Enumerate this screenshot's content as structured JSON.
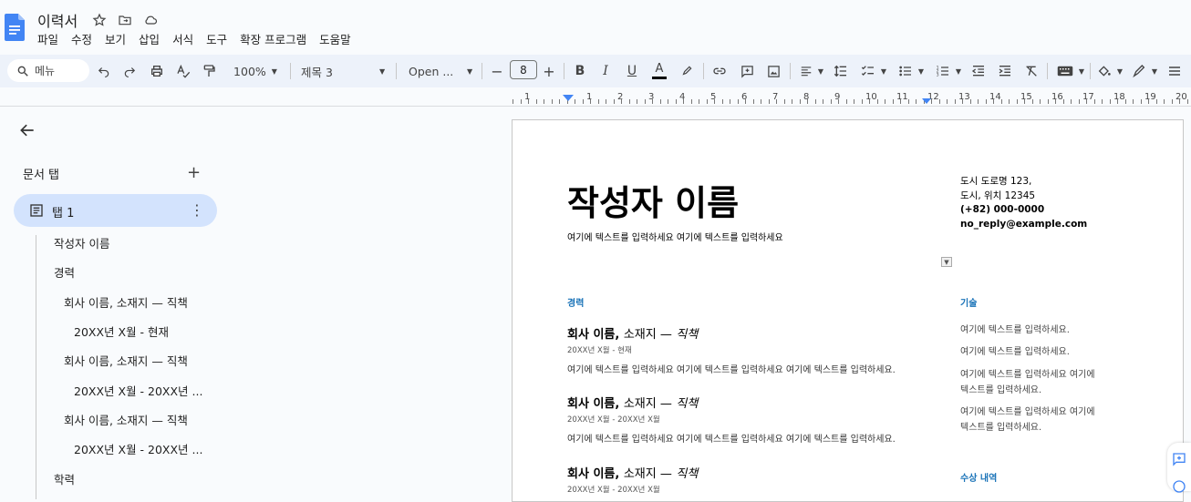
{
  "app": {
    "doc_title": "이력서"
  },
  "menu": [
    "파일",
    "수정",
    "보기",
    "삽입",
    "서식",
    "도구",
    "확장 프로그램",
    "도움말"
  ],
  "toolbar": {
    "search_placeholder": "메뉴",
    "zoom": "100%",
    "style": "제목 3",
    "font": "Open ...",
    "font_size": "8",
    "minus": "−",
    "plus": "+"
  },
  "ruler": {
    "labels": [
      "1",
      "1",
      "2",
      "3",
      "4",
      "5",
      "6",
      "7",
      "8",
      "9",
      "10",
      "11",
      "12",
      "13",
      "14",
      "15",
      "16",
      "17",
      "18",
      "19",
      "20"
    ]
  },
  "sidebar": {
    "section_title": "문서 탭",
    "tab_label": "탭 1",
    "outline": [
      {
        "text": "작성자 이름",
        "level": 1
      },
      {
        "text": "경력",
        "level": 1
      },
      {
        "text": "회사 이름, 소재지 — 직책",
        "level": 2
      },
      {
        "text": "20XX년 X월 - 현재",
        "level": 3
      },
      {
        "text": "회사 이름, 소재지 — 직책",
        "level": 2
      },
      {
        "text": "20XX년 X월 - 20XX년 ...",
        "level": 3
      },
      {
        "text": "회사 이름, 소재지 — 직책",
        "level": 2
      },
      {
        "text": "20XX년 X월 - 20XX년 ...",
        "level": 3
      },
      {
        "text": "학력",
        "level": 1
      }
    ]
  },
  "doc": {
    "name": "작성자 이름",
    "subtitle": "여기에 텍스트를 입력하세요 여기에 텍스트를 입력하세요",
    "address1": "도시 도로명 123,",
    "address2": "도시, 위치 12345",
    "phone": "(+82) 000-0000",
    "email": "no_reply@example.com",
    "experience_heading": "경력",
    "skills_heading": "기술",
    "awards_heading": "수상 내역",
    "jobs": [
      {
        "company": "회사 이름,",
        "location": "소재지 —",
        "title": "직책",
        "date": "20XX년 X월 - 현재",
        "desc": "여기에 텍스트를 입력하세요 여기에 텍스트를 입력하세요 여기에 텍스트를 입력하세요."
      },
      {
        "company": "회사 이름,",
        "location": "소재지 —",
        "title": "직책",
        "date": "20XX년 X월 - 20XX년 X월",
        "desc": "여기에 텍스트를 입력하세요 여기에 텍스트를 입력하세요 여기에 텍스트를 입력하세요."
      },
      {
        "company": "회사 이름,",
        "location": "소재지 —",
        "title": "직책",
        "date": "20XX년 X월 - 20XX년 X월",
        "desc": ""
      }
    ],
    "skills": [
      "여기에 텍스트를 입력하세요.",
      "여기에 텍스트를 입력하세요.",
      "여기에 텍스트를 입력하세요 여기에",
      "텍스트를 입력하세요.",
      "여기에 텍스트를 입력하세요 여기에",
      "텍스트를 입력하세요."
    ]
  }
}
